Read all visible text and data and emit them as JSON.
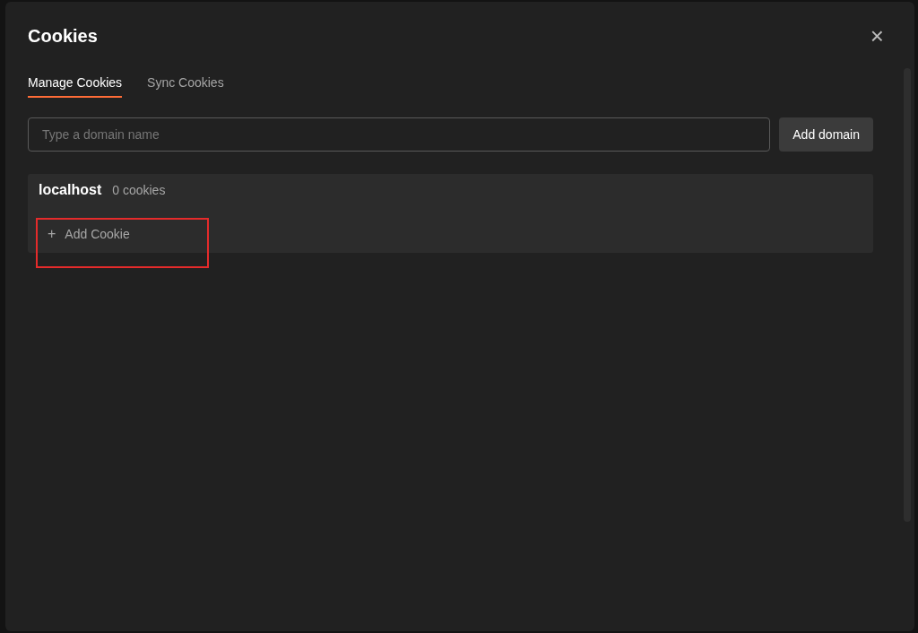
{
  "dialog": {
    "title": "Cookies",
    "close": "×"
  },
  "tabs": [
    {
      "label": "Manage Cookies",
      "selected": true
    },
    {
      "label": "Sync Cookies",
      "selected": false
    }
  ],
  "domain_input": {
    "placeholder": "Type a domain name"
  },
  "add_domain_button": "Add domain",
  "domains": [
    {
      "name": "localhost",
      "count": "0 cookies",
      "add_label": "Add Cookie",
      "add_icon": "+"
    }
  ]
}
